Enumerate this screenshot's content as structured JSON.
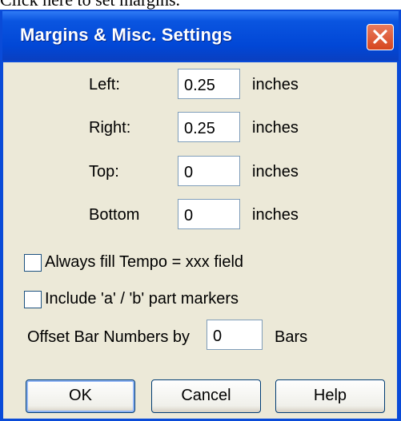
{
  "caption": "Click here to set margins.",
  "dialog": {
    "title": "Margins & Misc. Settings",
    "fields": [
      {
        "label": "Left:",
        "value": "0.25",
        "unit": "inches"
      },
      {
        "label": "Right:",
        "value": "0.25",
        "unit": "inches"
      },
      {
        "label": "Top:",
        "value": "0",
        "unit": "inches"
      },
      {
        "label": "Bottom",
        "value": "0",
        "unit": "inches"
      }
    ],
    "checkboxes": [
      {
        "label": "Always fill Tempo = xxx field",
        "checked": false
      },
      {
        "label": "Include 'a' / 'b' part markers",
        "checked": false
      }
    ],
    "offset": {
      "label": "Offset Bar Numbers by",
      "value": "0",
      "unit": "Bars"
    },
    "buttons": {
      "ok": "OK",
      "cancel": "Cancel",
      "help": "Help"
    }
  }
}
